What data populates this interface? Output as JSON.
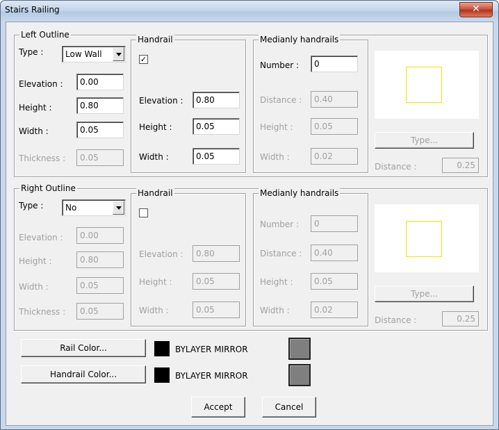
{
  "window": {
    "title": "Stairs Railing",
    "close_glyph": "✕"
  },
  "left": {
    "group_title": "Left Outline",
    "type_label": "Type :",
    "type_value": "Low Wall",
    "elevation_label": "Elevation :",
    "elevation_value": "0.00",
    "height_label": "Height :",
    "height_value": "0.80",
    "width_label": "Width :",
    "width_value": "0.05",
    "thickness_label": "Thickness :",
    "thickness_value": "0.05",
    "handrail": {
      "title": "Handrail",
      "checked_glyph": "✓",
      "elevation_label": "Elevation :",
      "elevation_value": "0.80",
      "height_label": "Height :",
      "height_value": "0.05",
      "width_label": "Width :",
      "width_value": "0.05"
    },
    "medianly": {
      "title": "Medianly handrails",
      "number_label": "Number :",
      "number_value": "0",
      "distance_label": "Distance :",
      "distance_value": "0.40",
      "height_label": "Height :",
      "height_value": "0.05",
      "width_label": "Width :",
      "width_value": "0.02"
    },
    "type_button": "Type...",
    "distance_label": "Distance :",
    "distance_value": "0.25"
  },
  "right": {
    "group_title": "Right Outline",
    "type_label": "Type :",
    "type_value": "No",
    "elevation_label": "Elevation :",
    "elevation_value": "0.00",
    "height_label": "Height :",
    "height_value": "0.80",
    "width_label": "Width :",
    "width_value": "0.05",
    "thickness_label": "Thickness :",
    "thickness_value": "0.05",
    "handrail": {
      "title": "Handrail",
      "elevation_label": "Elevation :",
      "elevation_value": "0.80",
      "height_label": "Height :",
      "height_value": "0.05",
      "width_label": "Width :",
      "width_value": "0.05"
    },
    "medianly": {
      "title": "Medianly handrails",
      "number_label": "Number :",
      "number_value": "0",
      "distance_label": "Distance :",
      "distance_value": "0.40",
      "height_label": "Height :",
      "height_value": "0.05",
      "width_label": "Width :",
      "width_value": "0.02"
    },
    "type_button": "Type...",
    "distance_label": "Distance :",
    "distance_value": "0.25"
  },
  "colors": {
    "rail_button": "Rail Color...",
    "rail_text": "BYLAYER MIRROR",
    "handrail_button": "Handrail Color...",
    "handrail_text": "BYLAYER MIRROR",
    "swatch_color": "#000000",
    "mirror_color": "#7f7f7f",
    "preview_line_color": "#e8e800"
  },
  "footer": {
    "accept": "Accept",
    "cancel": "Cancel"
  }
}
